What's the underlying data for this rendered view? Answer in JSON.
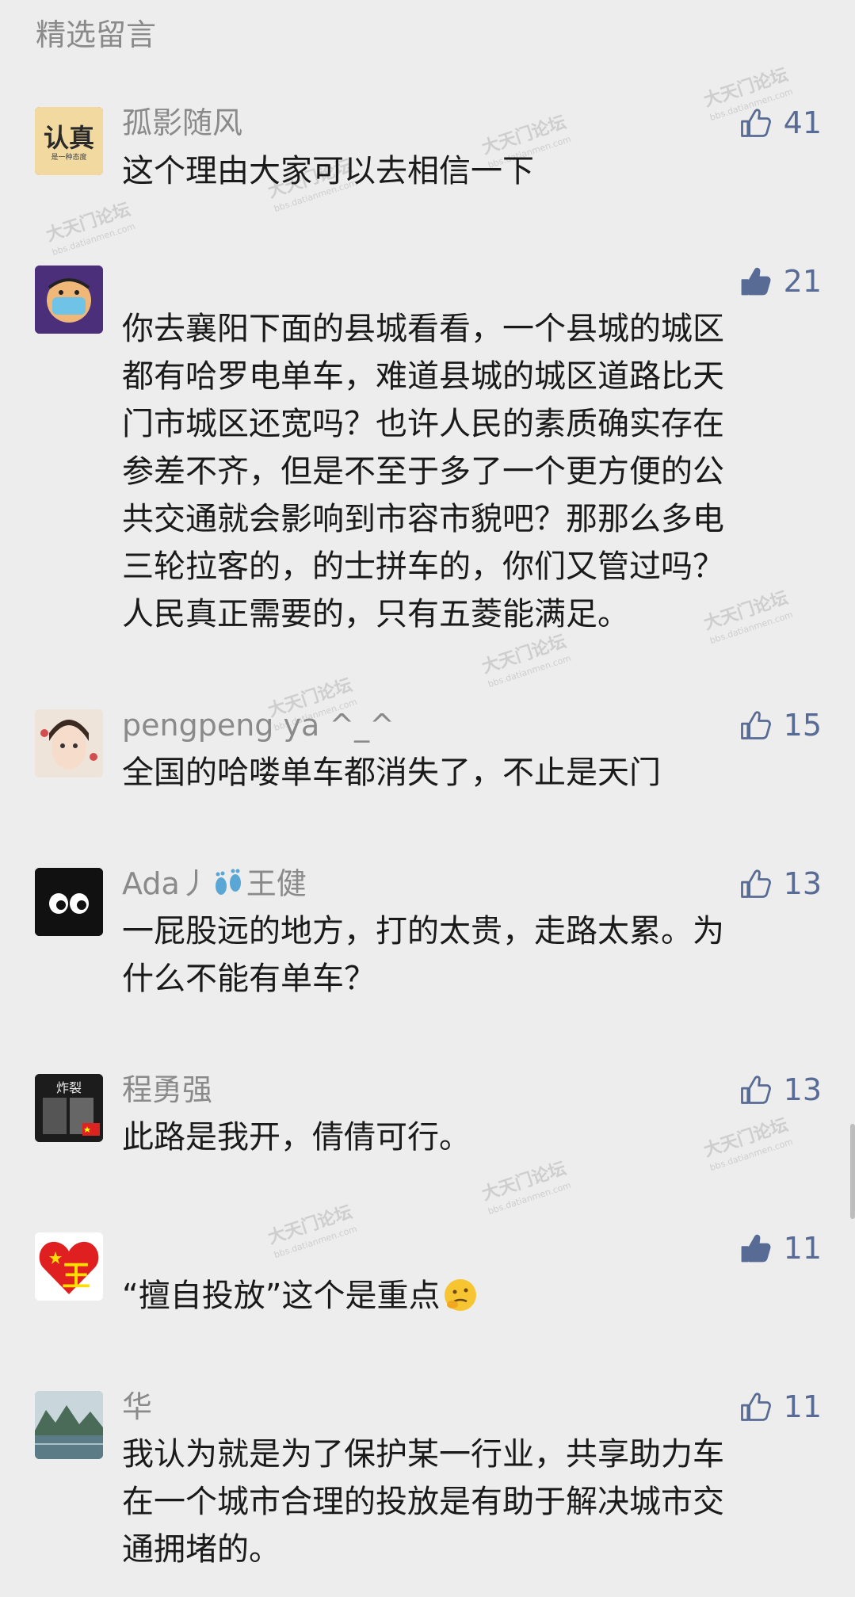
{
  "section_title": "精选留言",
  "watermark": {
    "main": "大天门论坛",
    "sub": "bbs.datianmen.com"
  },
  "accent_color": "#576b95",
  "comments": [
    {
      "nickname": "孤影随风",
      "avatar_text_main": "认真",
      "avatar_text_sub": "是一种态度",
      "likes": "41",
      "liked": false,
      "lines": [
        "这个理由大家可以去相信一下"
      ]
    },
    {
      "nickname": "",
      "likes": "21",
      "liked": true,
      "lines": [
        "你去襄阳下面的县城看看，一个县城的城区",
        "都有哈罗电单车，难道县城的城区道路比天",
        "门市城区还宽吗？也许人民的素质确实存在",
        "参差不齐，但是不至于多了一个更方便的公",
        "共交通就会影响到市容市貌吧？那那么多电",
        "三轮拉客的，的士拼车的，你们又管过吗？",
        "人民真正需要的，只有五菱能满足。"
      ]
    },
    {
      "nickname": "pengpeng ya ^_^",
      "likes": "15",
      "liked": false,
      "lines": [
        "全国的哈喽单车都消失了，不止是天门"
      ]
    },
    {
      "nickname_pre": "Ada丿",
      "nickname_post": "王健",
      "likes": "13",
      "liked": false,
      "lines": [
        "一屁股远的地方，打的太贵，走路太累。为",
        "什么不能有单车？"
      ]
    },
    {
      "nickname": "程勇强",
      "avatar_text_main": "炸裂",
      "likes": "13",
      "liked": false,
      "lines": [
        "此路是我开，倩倩可行。"
      ]
    },
    {
      "nickname": "",
      "avatar_text_main": "王",
      "likes": "11",
      "liked": true,
      "lines": [
        "“擅自投放”这个是重点"
      ]
    },
    {
      "nickname": "华",
      "likes": "11",
      "liked": false,
      "lines": [
        "我认为就是为了保护某一行业，共享助力车",
        "在一个城市合理的投放是有助于解决城市交",
        "通拥堵的。"
      ]
    }
  ]
}
